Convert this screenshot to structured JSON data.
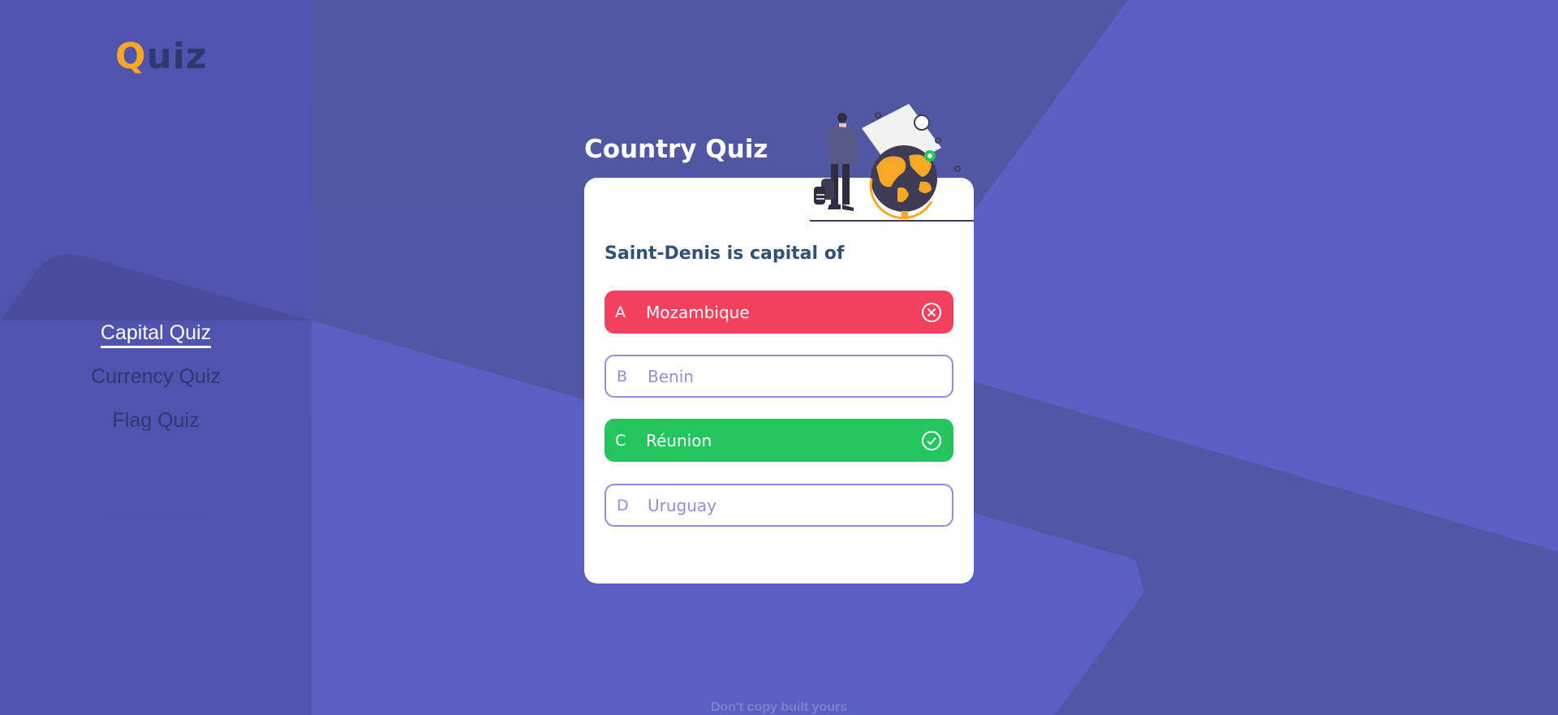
{
  "app": {
    "logo_first": "Q",
    "logo_rest": "uiz"
  },
  "sidebar": {
    "items": [
      {
        "label": "Capital Quiz",
        "active": true
      },
      {
        "label": "Currency Quiz",
        "active": false
      },
      {
        "label": "Flag Quiz",
        "active": false
      }
    ]
  },
  "quiz": {
    "title": "Country Quiz",
    "question": "Saint-Denis is capital of",
    "options": [
      {
        "letter": "A",
        "text": "Mozambique",
        "state": "wrong",
        "icon": "x-circle-icon"
      },
      {
        "letter": "B",
        "text": "Benin",
        "state": "neutral"
      },
      {
        "letter": "C",
        "text": "Réunion",
        "state": "correct",
        "icon": "check-circle-icon"
      },
      {
        "letter": "D",
        "text": "Uruguay",
        "state": "neutral"
      }
    ]
  },
  "footer": {
    "text": "Don't copy built yours"
  },
  "colors": {
    "background": "#5a5fc4",
    "accent": "#f9a826",
    "wrong": "#f2415f",
    "correct": "#22c55e",
    "option_border": "#8e90db",
    "question": "#2f527b"
  }
}
